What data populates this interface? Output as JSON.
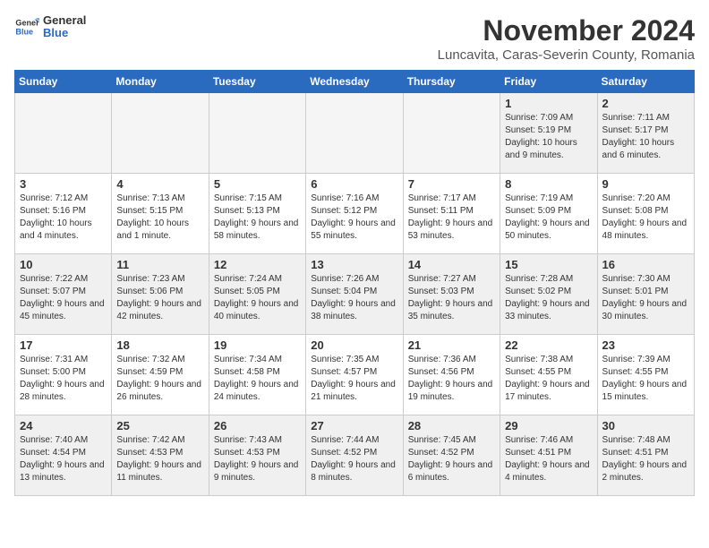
{
  "logo": {
    "general": "General",
    "blue": "Blue"
  },
  "header": {
    "month": "November 2024",
    "location": "Luncavita, Caras-Severin County, Romania"
  },
  "weekdays": [
    "Sunday",
    "Monday",
    "Tuesday",
    "Wednesday",
    "Thursday",
    "Friday",
    "Saturday"
  ],
  "weeks": [
    [
      {
        "day": "",
        "info": ""
      },
      {
        "day": "",
        "info": ""
      },
      {
        "day": "",
        "info": ""
      },
      {
        "day": "",
        "info": ""
      },
      {
        "day": "",
        "info": ""
      },
      {
        "day": "1",
        "info": "Sunrise: 7:09 AM\nSunset: 5:19 PM\nDaylight: 10 hours and 9 minutes."
      },
      {
        "day": "2",
        "info": "Sunrise: 7:11 AM\nSunset: 5:17 PM\nDaylight: 10 hours and 6 minutes."
      }
    ],
    [
      {
        "day": "3",
        "info": "Sunrise: 7:12 AM\nSunset: 5:16 PM\nDaylight: 10 hours and 4 minutes."
      },
      {
        "day": "4",
        "info": "Sunrise: 7:13 AM\nSunset: 5:15 PM\nDaylight: 10 hours and 1 minute."
      },
      {
        "day": "5",
        "info": "Sunrise: 7:15 AM\nSunset: 5:13 PM\nDaylight: 9 hours and 58 minutes."
      },
      {
        "day": "6",
        "info": "Sunrise: 7:16 AM\nSunset: 5:12 PM\nDaylight: 9 hours and 55 minutes."
      },
      {
        "day": "7",
        "info": "Sunrise: 7:17 AM\nSunset: 5:11 PM\nDaylight: 9 hours and 53 minutes."
      },
      {
        "day": "8",
        "info": "Sunrise: 7:19 AM\nSunset: 5:09 PM\nDaylight: 9 hours and 50 minutes."
      },
      {
        "day": "9",
        "info": "Sunrise: 7:20 AM\nSunset: 5:08 PM\nDaylight: 9 hours and 48 minutes."
      }
    ],
    [
      {
        "day": "10",
        "info": "Sunrise: 7:22 AM\nSunset: 5:07 PM\nDaylight: 9 hours and 45 minutes."
      },
      {
        "day": "11",
        "info": "Sunrise: 7:23 AM\nSunset: 5:06 PM\nDaylight: 9 hours and 42 minutes."
      },
      {
        "day": "12",
        "info": "Sunrise: 7:24 AM\nSunset: 5:05 PM\nDaylight: 9 hours and 40 minutes."
      },
      {
        "day": "13",
        "info": "Sunrise: 7:26 AM\nSunset: 5:04 PM\nDaylight: 9 hours and 38 minutes."
      },
      {
        "day": "14",
        "info": "Sunrise: 7:27 AM\nSunset: 5:03 PM\nDaylight: 9 hours and 35 minutes."
      },
      {
        "day": "15",
        "info": "Sunrise: 7:28 AM\nSunset: 5:02 PM\nDaylight: 9 hours and 33 minutes."
      },
      {
        "day": "16",
        "info": "Sunrise: 7:30 AM\nSunset: 5:01 PM\nDaylight: 9 hours and 30 minutes."
      }
    ],
    [
      {
        "day": "17",
        "info": "Sunrise: 7:31 AM\nSunset: 5:00 PM\nDaylight: 9 hours and 28 minutes."
      },
      {
        "day": "18",
        "info": "Sunrise: 7:32 AM\nSunset: 4:59 PM\nDaylight: 9 hours and 26 minutes."
      },
      {
        "day": "19",
        "info": "Sunrise: 7:34 AM\nSunset: 4:58 PM\nDaylight: 9 hours and 24 minutes."
      },
      {
        "day": "20",
        "info": "Sunrise: 7:35 AM\nSunset: 4:57 PM\nDaylight: 9 hours and 21 minutes."
      },
      {
        "day": "21",
        "info": "Sunrise: 7:36 AM\nSunset: 4:56 PM\nDaylight: 9 hours and 19 minutes."
      },
      {
        "day": "22",
        "info": "Sunrise: 7:38 AM\nSunset: 4:55 PM\nDaylight: 9 hours and 17 minutes."
      },
      {
        "day": "23",
        "info": "Sunrise: 7:39 AM\nSunset: 4:55 PM\nDaylight: 9 hours and 15 minutes."
      }
    ],
    [
      {
        "day": "24",
        "info": "Sunrise: 7:40 AM\nSunset: 4:54 PM\nDaylight: 9 hours and 13 minutes."
      },
      {
        "day": "25",
        "info": "Sunrise: 7:42 AM\nSunset: 4:53 PM\nDaylight: 9 hours and 11 minutes."
      },
      {
        "day": "26",
        "info": "Sunrise: 7:43 AM\nSunset: 4:53 PM\nDaylight: 9 hours and 9 minutes."
      },
      {
        "day": "27",
        "info": "Sunrise: 7:44 AM\nSunset: 4:52 PM\nDaylight: 9 hours and 8 minutes."
      },
      {
        "day": "28",
        "info": "Sunrise: 7:45 AM\nSunset: 4:52 PM\nDaylight: 9 hours and 6 minutes."
      },
      {
        "day": "29",
        "info": "Sunrise: 7:46 AM\nSunset: 4:51 PM\nDaylight: 9 hours and 4 minutes."
      },
      {
        "day": "30",
        "info": "Sunrise: 7:48 AM\nSunset: 4:51 PM\nDaylight: 9 hours and 2 minutes."
      }
    ]
  ]
}
